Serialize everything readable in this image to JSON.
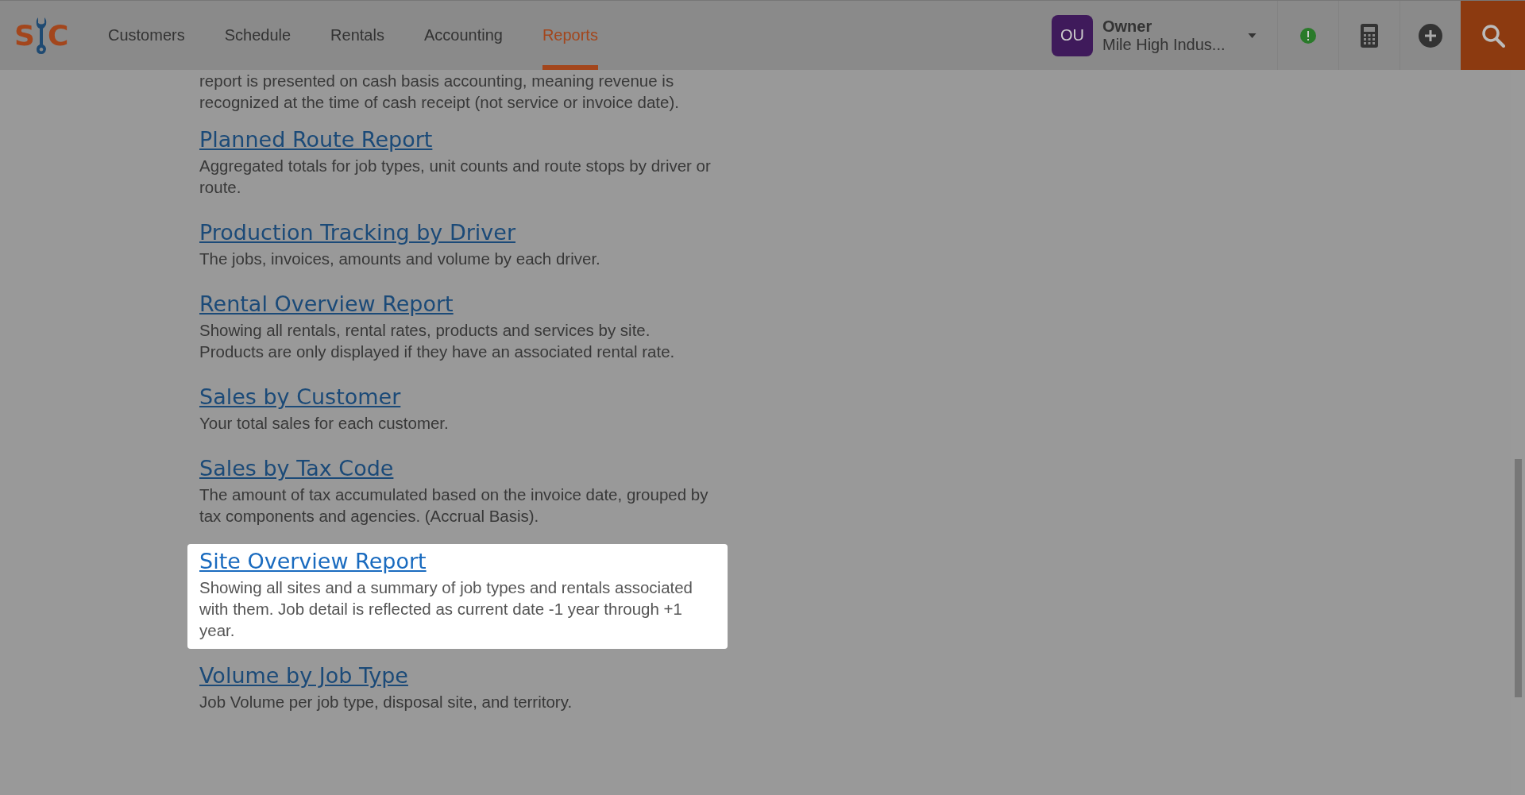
{
  "header": {
    "logo": {
      "letters_left": "S",
      "letters_right": "C"
    },
    "nav": [
      {
        "label": "Customers",
        "selected": false
      },
      {
        "label": "Schedule",
        "selected": false
      },
      {
        "label": "Rentals",
        "selected": false
      },
      {
        "label": "Accounting",
        "selected": false
      },
      {
        "label": "Reports",
        "selected": true
      }
    ],
    "user": {
      "initials": "OU",
      "role": "Owner",
      "company": "Mile High Indus..."
    }
  },
  "intro": "report is presented on cash basis accounting, meaning revenue is recognized at the time of cash receipt (not service or invoice date).",
  "reports": [
    {
      "title": "Planned Route Report",
      "description": "Aggregated totals for job types, unit counts and route stops by driver or route.",
      "highlighted": false
    },
    {
      "title": "Production Tracking by Driver",
      "description": "The jobs, invoices, amounts and volume by each driver.",
      "highlighted": false
    },
    {
      "title": "Rental Overview Report",
      "description": "Showing all rentals, rental rates, products and services by site. Products are only displayed if they have an associated rental rate.",
      "highlighted": false
    },
    {
      "title": "Sales by Customer",
      "description": "Your total sales for each customer.",
      "highlighted": false
    },
    {
      "title": "Sales by Tax Code",
      "description": "The amount of tax accumulated based on the invoice date, grouped by tax components and agencies. (Accrual Basis).",
      "highlighted": false
    },
    {
      "title": "Site Overview Report",
      "description": "Showing all sites and a summary of job types and rentals associated with them. Job detail is reflected as current date -1 year through +1 year.",
      "highlighted": true
    },
    {
      "title": "Volume by Job Type",
      "description": "Job Volume per job type, disposal site, and territory.",
      "highlighted": false
    }
  ]
}
